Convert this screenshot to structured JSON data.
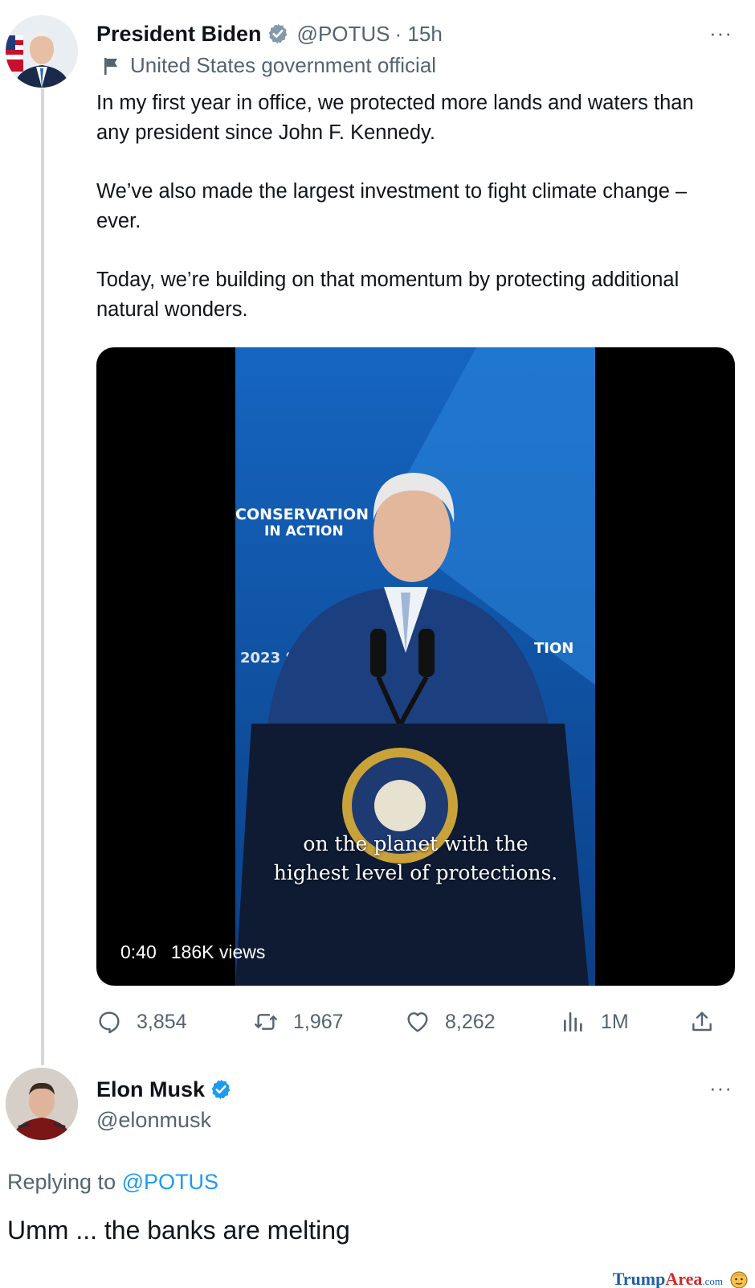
{
  "tweet": {
    "author_name": "President Biden",
    "handle": "@POTUS",
    "time": "· 15h",
    "label": "United States government official",
    "paragraphs": [
      "In my first year in office, we protected more lands and waters than any president since John F. Kennedy.",
      "We’ve also made the largest investment to fight climate change – ever.",
      "Today, we’re building on that momentum by protecting additional natural wonders."
    ],
    "more_icon": "···",
    "video": {
      "backdrop_line1": "CONSERVATION",
      "backdrop_line2": "IN ACTION",
      "backdrop_year": "2023 S",
      "backdrop_right": "TION",
      "caption_line1": "on the planet with the",
      "caption_line2": "highest level of protections.",
      "duration": "0:40",
      "views": "186K views"
    },
    "actions": {
      "replies": "3,854",
      "retweets": "1,967",
      "likes": "8,262",
      "views": "1M"
    }
  },
  "reply": {
    "author_name": "Elon Musk",
    "handle": "@elonmusk",
    "replying_prefix": "Replying to",
    "replying_mention": "@POTUS",
    "text": "Umm ... the banks are melting",
    "more_icon": "···"
  },
  "watermark": {
    "part1": "Trump",
    "part2": "Area",
    "suffix": ".com"
  },
  "colors": {
    "accent": "#1d9bf0",
    "muted": "#536471",
    "thread_line": "#cfd9de"
  }
}
